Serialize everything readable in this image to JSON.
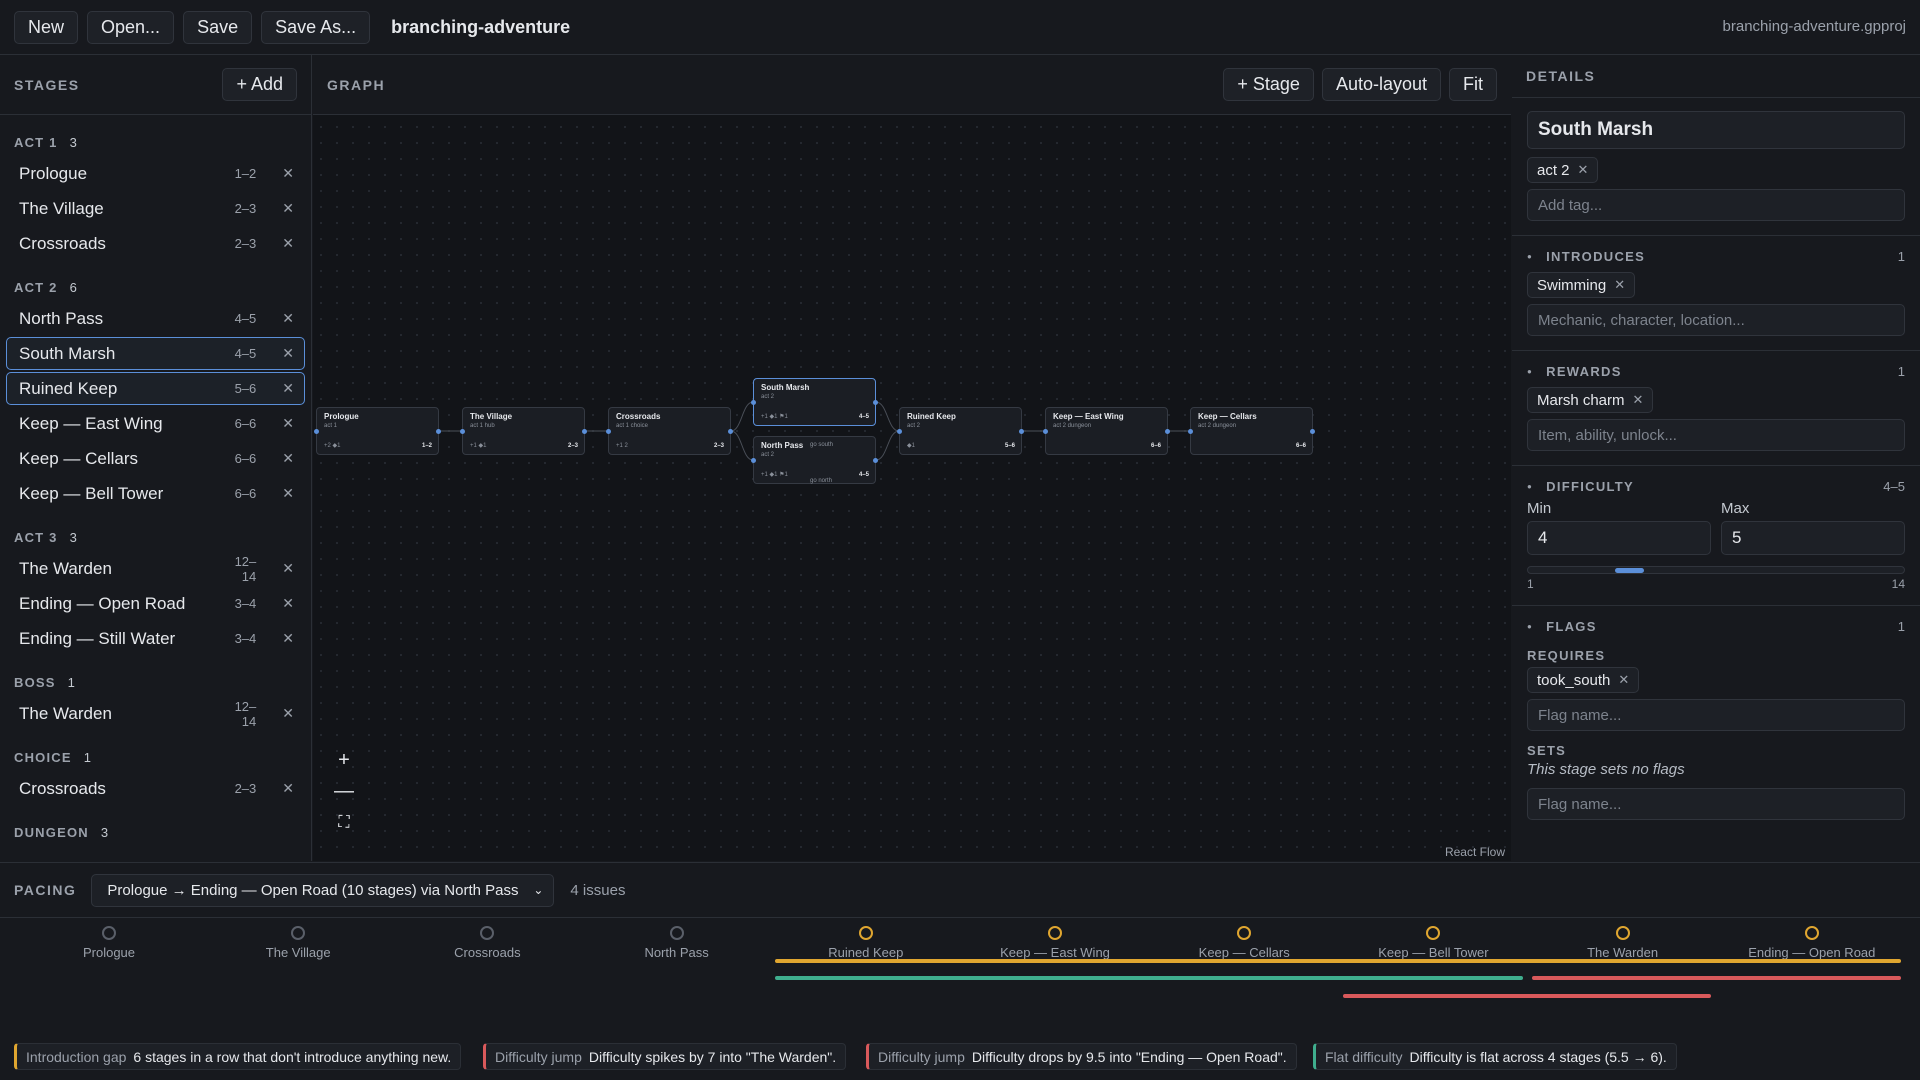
{
  "toolbar": {
    "new": "New",
    "open": "Open...",
    "save": "Save",
    "save_as": "Save As...",
    "project": "branching-adventure",
    "filename": "branching-adventure.gpproj"
  },
  "stages_panel": {
    "title": "STAGES",
    "add": "+ Add",
    "groups": [
      {
        "name": "ACT 1",
        "count": "3",
        "stages": [
          {
            "name": "Prologue",
            "range": "1–2"
          },
          {
            "name": "The Village",
            "range": "2–3"
          },
          {
            "name": "Crossroads",
            "range": "2–3"
          }
        ]
      },
      {
        "name": "ACT 2",
        "count": "6",
        "stages": [
          {
            "name": "North Pass",
            "range": "4–5"
          },
          {
            "name": "South Marsh",
            "range": "4–5",
            "selected": true
          },
          {
            "name": "Ruined Keep",
            "range": "5–6",
            "selected": true
          },
          {
            "name": "Keep — East Wing",
            "range": "6–6"
          },
          {
            "name": "Keep — Cellars",
            "range": "6–6"
          },
          {
            "name": "Keep — Bell Tower",
            "range": "6–6"
          }
        ]
      },
      {
        "name": "ACT 3",
        "count": "3",
        "stages": [
          {
            "name": "The Warden",
            "range": "12–14"
          },
          {
            "name": "Ending — Open Road",
            "range": "3–4"
          },
          {
            "name": "Ending — Still Water",
            "range": "3–4"
          }
        ]
      },
      {
        "name": "BOSS",
        "count": "1",
        "stages": [
          {
            "name": "The Warden",
            "range": "12–14"
          }
        ]
      },
      {
        "name": "CHOICE",
        "count": "1",
        "stages": [
          {
            "name": "Crossroads",
            "range": "2–3"
          }
        ]
      },
      {
        "name": "DUNGEON",
        "count": "3",
        "stages": []
      }
    ]
  },
  "graph": {
    "title": "GRAPH",
    "add_stage": "+ Stage",
    "auto_layout": "Auto-layout",
    "fit": "Fit",
    "attribution": "React Flow",
    "zoom_in": "+",
    "zoom_out": "—",
    "fit_icon": "⛶",
    "nodes": [
      {
        "title": "Prologue",
        "tag": "act 1",
        "stats": "+2  ◆1",
        "range": "1–2"
      },
      {
        "title": "The Village",
        "tag": "act 1   hub",
        "stats": "+1  ◆1",
        "range": "2–3"
      },
      {
        "title": "Crossroads",
        "tag": "act 1   choice",
        "stats": "+1 2",
        "range": "2–3"
      },
      {
        "title": "South Marsh",
        "tag": "act 2",
        "stats": "+1  ◆1  ⚑1",
        "range": "4–5",
        "selected": true
      },
      {
        "title": "North Pass",
        "tag": "act 2",
        "stats": "+1  ◆1  ⚑1",
        "range": "4–5"
      },
      {
        "title": "Ruined Keep",
        "tag": "act 2",
        "stats": "◆1",
        "range": "5–6"
      },
      {
        "title": "Keep — East Wing",
        "tag": "act 2   dungeon",
        "stats": "",
        "range": "6–6"
      },
      {
        "title": "Keep — Cellars",
        "tag": "act 2   dungeon",
        "stats": "",
        "range": "6–6"
      }
    ],
    "edge_labels": [
      "go south",
      "go north"
    ]
  },
  "details": {
    "title": "DETAILS",
    "stage_name": "South Marsh",
    "tags": [
      "act 2"
    ],
    "add_tag_placeholder": "Add tag...",
    "introduces": {
      "title": "INTRODUCES",
      "count": "1",
      "items": [
        "Swimming"
      ],
      "placeholder": "Mechanic, character, location..."
    },
    "rewards": {
      "title": "REWARDS",
      "count": "1",
      "items": [
        "Marsh charm"
      ],
      "placeholder": "Item, ability, unlock..."
    },
    "difficulty": {
      "title": "DIFFICULTY",
      "summary": "4–5",
      "min_label": "Min",
      "max_label": "Max",
      "min": "4",
      "max": "5",
      "scale_min": "1",
      "scale_max": "14",
      "min_value": 4,
      "max_value": 5,
      "accent": "#5b8fd9"
    },
    "flags": {
      "title": "FLAGS",
      "count": "1",
      "requires_label": "REQUIRES",
      "requires": [
        "took_south"
      ],
      "requires_placeholder": "Flag name...",
      "sets_label": "SETS",
      "sets_empty": "This stage sets no flags",
      "sets_placeholder": "Flag name..."
    }
  },
  "pacing": {
    "title": "PACING",
    "path": "Prologue → Ending — Open Road (10 stages) via North Pass",
    "issue_count": "4 issues",
    "stages": [
      {
        "name": "Prologue",
        "warn": false
      },
      {
        "name": "The Village",
        "warn": false
      },
      {
        "name": "Crossroads",
        "warn": false
      },
      {
        "name": "North Pass",
        "warn": false
      },
      {
        "name": "Ruined Keep",
        "warn": true
      },
      {
        "name": "Keep — East Wing",
        "warn": true
      },
      {
        "name": "Keep — Cellars",
        "warn": true
      },
      {
        "name": "Keep — Bell Tower",
        "warn": true
      },
      {
        "name": "The Warden",
        "warn": true
      },
      {
        "name": "Ending — Open Road",
        "warn": true
      }
    ],
    "colors": {
      "warning": "#e0a630",
      "flat": "#3fae8e",
      "jump": "#d9595b"
    },
    "issues": [
      {
        "kind": "Introduction gap",
        "text": "6 stages in a row that don't introduce anything new.",
        "color": "#e0a630"
      },
      {
        "kind": "Difficulty jump",
        "text": "Difficulty spikes by 7 into \"The Warden\".",
        "color": "#d9595b"
      },
      {
        "kind": "Difficulty jump",
        "text": "Difficulty drops by 9.5 into \"Ending — Open Road\".",
        "color": "#d9595b"
      },
      {
        "kind": "Flat difficulty",
        "text": "Difficulty is flat across 4 stages (5.5 → 6).",
        "color": "#3fae8e"
      }
    ]
  }
}
